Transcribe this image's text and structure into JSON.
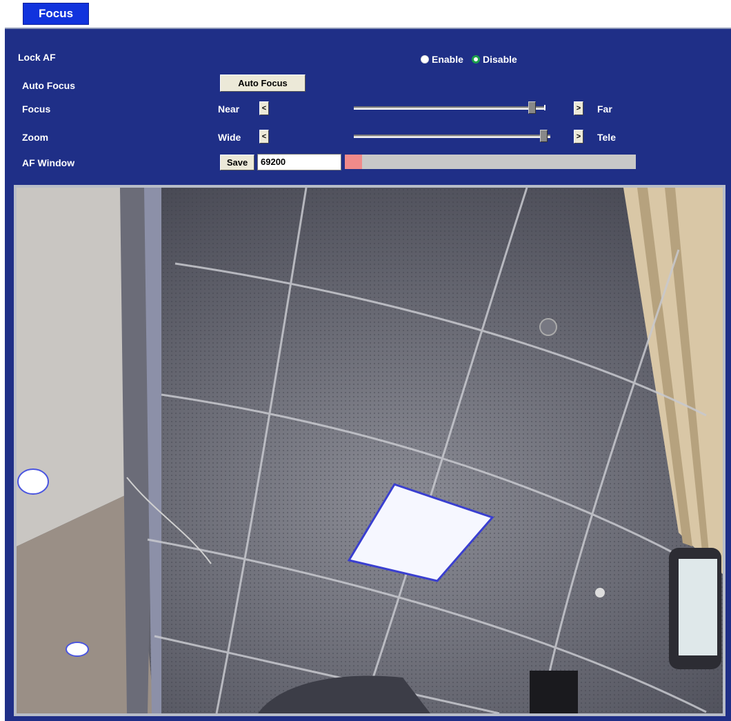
{
  "tab": {
    "label": "Focus"
  },
  "rows": {
    "lock_af": {
      "label": "Lock AF",
      "enable_label": "Enable",
      "disable_label": "Disable",
      "selected": "Disable"
    },
    "auto_focus": {
      "label": "Auto Focus",
      "button_label": "Auto Focus"
    },
    "focus": {
      "label": "Focus",
      "min_label": "Near",
      "max_label": "Far",
      "level": 0.94
    },
    "zoom": {
      "label": "Zoom",
      "min_label": "Wide",
      "max_label": "Tele",
      "level": 0.97
    },
    "af_window": {
      "label": "AF Window",
      "save_label": "Save",
      "value": "69200",
      "level": 0.06
    }
  },
  "colors": {
    "panel_bg": "#1f2f87",
    "tab_bg": "#1133dd",
    "radio_selected": "#1ca04a",
    "af_bar_fill": "#f08a8a"
  },
  "icons": {
    "decrease": "chevron-left-icon",
    "increase": "chevron-right-icon"
  }
}
